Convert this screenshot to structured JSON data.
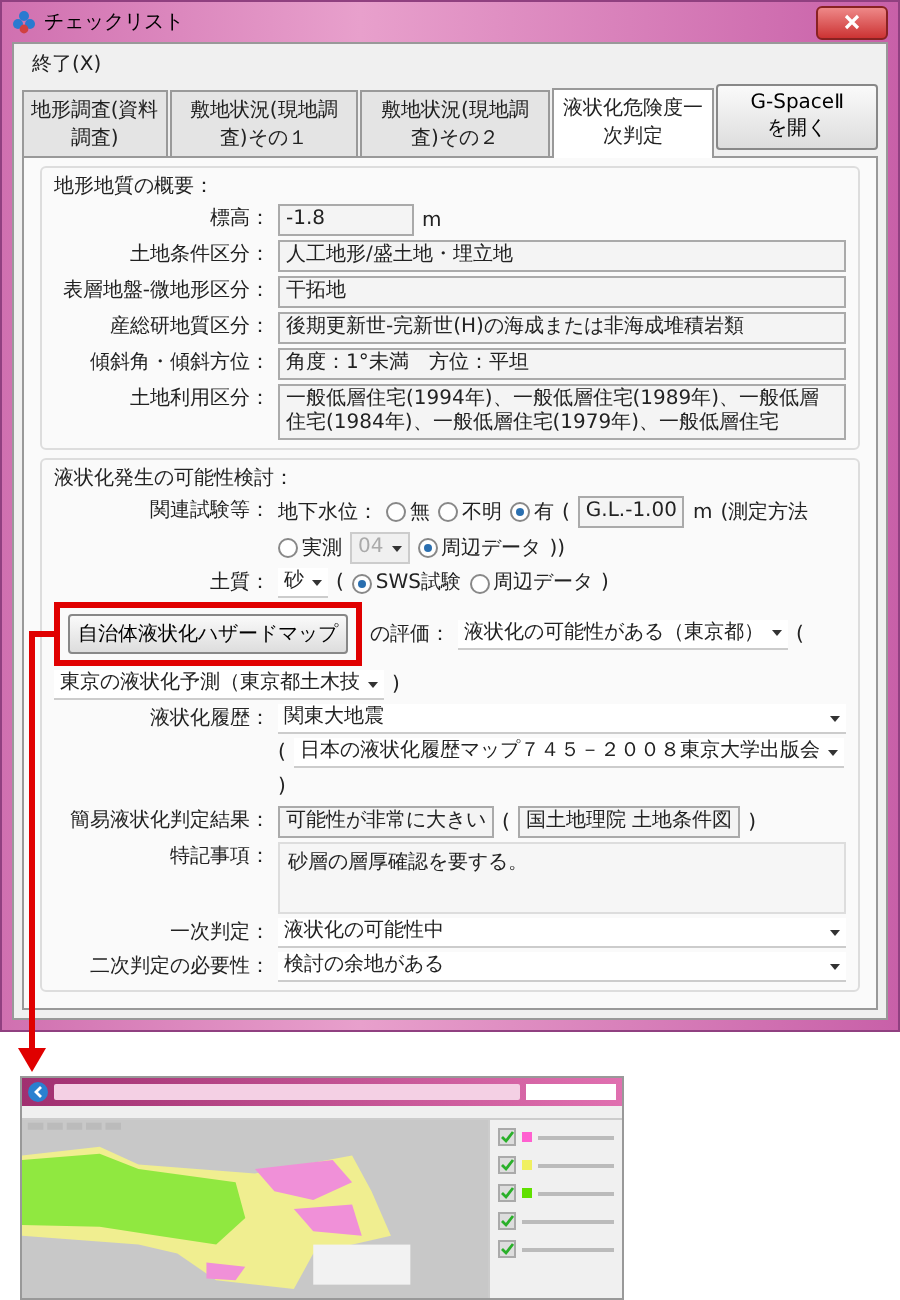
{
  "window": {
    "title": "チェックリスト"
  },
  "map_legend": [
    {
      "checked": true,
      "color": "#ff60d0"
    },
    {
      "checked": true,
      "color": "#f0f060"
    },
    {
      "checked": true,
      "color": "#60e000"
    },
    {
      "checked": true
    },
    {
      "checked": true
    }
  ],
  "menu": [
    {
      "label": "終了(X)"
    }
  ],
  "tabs": [
    {
      "label": "地形調査(資料調査)",
      "selected": false
    },
    {
      "label": "敷地状況(現地調査)その１",
      "selected": false
    },
    {
      "label": "敷地状況(現地調査)その２",
      "selected": false
    },
    {
      "label": "液状化危険度一次判定",
      "selected": true
    }
  ],
  "open_button": {
    "label": "G-SpaceⅡ を開く"
  },
  "terrain": {
    "title": "地形地質の概要：",
    "elevation": {
      "label": "標高：",
      "value": "-1.8",
      "unit": "m"
    },
    "fields": [
      {
        "label": "土地条件区分：",
        "value": "人工地形/盛土地・埋立地"
      },
      {
        "label": "表層地盤-微地形区分：",
        "value": "干拓地"
      },
      {
        "label": "産総研地質区分：",
        "value": "後期更新世-完新世(H)の海成または非海成堆積岩類"
      },
      {
        "label": "傾斜角・傾斜方位：",
        "value": "角度：1°未満　方位：平坦"
      },
      {
        "label": "土地利用区分：",
        "value": "一般低層住宅(1994年)、一般低層住宅(1989年)、一般低層住宅(1984年)、一般低層住宅(1979年)、一般低層住宅"
      }
    ]
  },
  "liquefaction": {
    "title": "液状化発生の可能性検討：",
    "rows": [
      {
        "label": "関連試験等：",
        "items": [
          {
            "kind": "text",
            "text": "地下水位："
          },
          {
            "kind": "radio",
            "label": "無",
            "selected": false
          },
          {
            "kind": "radio",
            "label": "不明",
            "selected": false
          },
          {
            "kind": "radio",
            "label": "有",
            "selected": true
          },
          {
            "kind": "text",
            "text": "("
          },
          {
            "kind": "field",
            "value": "G.L.-1.00"
          },
          {
            "kind": "text",
            "text": "m"
          },
          {
            "kind": "text",
            "text": "(測定方法"
          },
          {
            "kind": "radio",
            "label": "実測",
            "selected": false
          },
          {
            "kind": "dropdown",
            "value": "04",
            "disabled": true
          },
          {
            "kind": "radio",
            "label": "周辺データ",
            "selected": true
          },
          {
            "kind": "text",
            "text": "))"
          }
        ]
      },
      {
        "label": "土質：",
        "items": [
          {
            "kind": "dropdown",
            "value": "砂",
            "disabled": false
          },
          {
            "kind": "text",
            "text": "("
          },
          {
            "kind": "radio",
            "label": "SWS試験",
            "selected": true
          },
          {
            "kind": "radio",
            "label": "周辺データ",
            "selected": false
          },
          {
            "kind": "text",
            "text": ")"
          }
        ]
      },
      {
        "items": [
          {
            "kind": "button",
            "label": "自治体液状化ハザードマップ",
            "highlighted": true
          },
          {
            "kind": "text",
            "text": "の評価："
          },
          {
            "kind": "dropdown",
            "value": "液状化の可能性がある（東京都）",
            "disabled": false
          },
          {
            "kind": "text",
            "text": "("
          },
          {
            "kind": "dropdown",
            "value": "東京の液状化予測（東京都土木技",
            "disabled": false
          },
          {
            "kind": "text",
            "text": ")"
          }
        ]
      },
      {
        "label": "液状化履歴：",
        "items": [
          {
            "kind": "dropdown",
            "value": "関東大地震",
            "disabled": false
          }
        ]
      },
      {
        "items": [
          {
            "kind": "text",
            "text": "("
          },
          {
            "kind": "dropdown",
            "value": "日本の液状化履歴マップ７４５－２００８東京大学出版会",
            "disabled": false
          },
          {
            "kind": "text",
            "text": ")"
          }
        ]
      },
      {
        "label": "簡易液状化判定結果：",
        "items": [
          {
            "kind": "field",
            "value": "可能性が非常に大きい"
          },
          {
            "kind": "text",
            "text": "("
          },
          {
            "kind": "field",
            "value": "国土地理院 土地条件図"
          },
          {
            "kind": "text",
            "text": ")"
          }
        ]
      },
      {
        "label": "特記事項：",
        "items": [
          {
            "kind": "textarea",
            "value": "砂層の層厚確認を要する。"
          }
        ]
      },
      {
        "label": "一次判定：",
        "items": [
          {
            "kind": "dropdown",
            "value": "液状化の可能性中",
            "disabled": false
          }
        ]
      },
      {
        "label": "二次判定の必要性：",
        "items": [
          {
            "kind": "dropdown",
            "value": "検討の余地がある",
            "disabled": false
          }
        ]
      }
    ]
  }
}
